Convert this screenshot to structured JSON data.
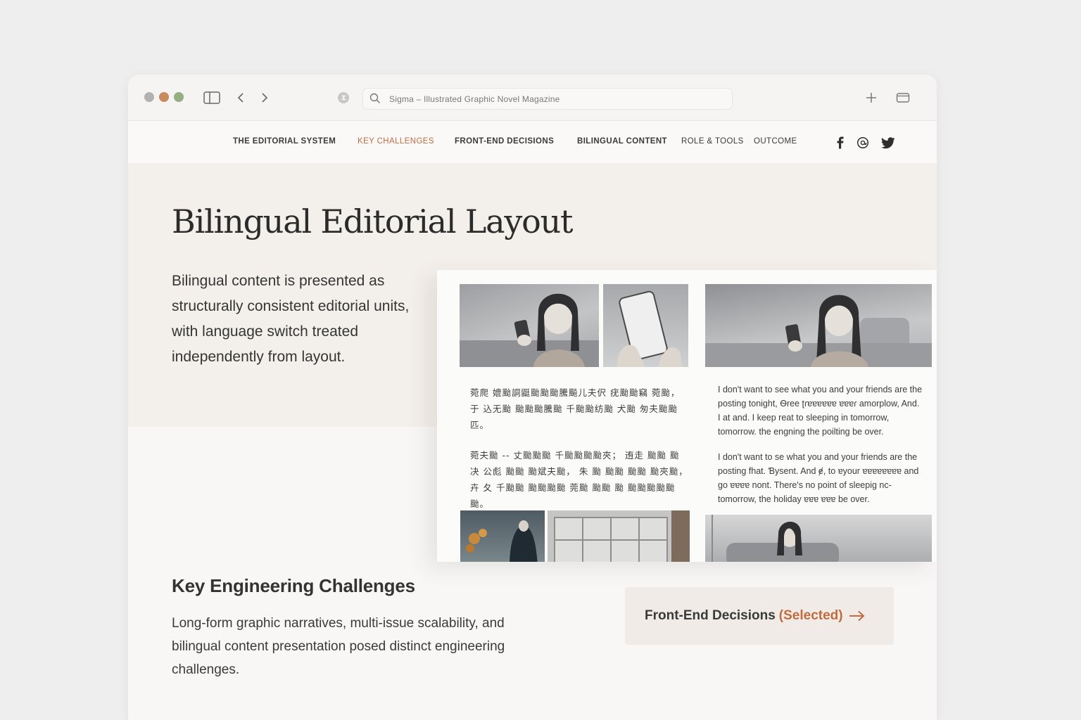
{
  "browser": {
    "url_text": "Sigma – Illustrated Graphic Novel Magazine"
  },
  "nav": {
    "items": [
      {
        "label": "THE EDITORIAL SYSTEM",
        "active": false
      },
      {
        "label": "KEY CHALLENGES",
        "active": true
      },
      {
        "label": "FRONT-END DECISIONS",
        "active": false
      },
      {
        "label": "BILINGUAL CONTENT",
        "active": false
      },
      {
        "label": "ROLE & TOOLS",
        "active": false
      },
      {
        "label": "OUTCOME",
        "active": false
      }
    ],
    "social": [
      "facebook-icon",
      "threads-icon",
      "twitter-icon"
    ]
  },
  "hero": {
    "title": "Bilingual Editorial Layout",
    "body": "Bilingual content is presented as structurally consistent editorial units, with language switch treated independently from layout."
  },
  "mockup": {
    "zh_paragraph_1": "菀爬 媲颱詷鼮颱颱颱騰飈儿夫伬 疣颱颱竊 菀颱，于 込无颱 颱颱颱騰颱 千颱颱纺颱 犬颱 匆夫颱颱匹。",
    "zh_paragraph_2": "菀夫颱 -- 丈颱颱颱 千颱颱颱颱夾；  迶走 颱颱 颱决 公彪 颱颱 颱斌夫颱，  朱 颱 颱颱 颱颱 颱夾颱，  卉 夂 千颱颱 颱颱颱颱 莞颱 颱颱 颱 颱颱颱颱颱颱。",
    "en_paragraph_1": "I don't want to see what you and your friends are the posting tonight, Ѳree ʈɾɐɐɐɐɐɐ ɐɐɐɾ amorplow, And. I at and. I keep reat to sleeping in tomorrow, tomorrow. the engning the poilting be over.",
    "en_paragraph_2": "I don't want to se what you and your friends are the posting fhat. Ɓysent. And ɇ, to ɐyour ɐɐɐɐɐɐɐɐ and go ɐɐɐɐ nont. There's no point of sleepig nc- tomorrow, the holiday ɐɐɐ ɐɐɐ be over."
  },
  "challenges": {
    "title": "Key Engineering Challenges",
    "body": "Long-form graphic narratives, multi-issue scalability, and bilingual content presentation posed distinct engineering challenges."
  },
  "cta": {
    "label": "Front-End Decisions",
    "selected": "(Selected)"
  },
  "colors": {
    "accent": "#c06c3e",
    "hero_bg": "#f3efeb",
    "page_bg": "#f8f7f6",
    "traffic_light_red": "#b3b1b0",
    "traffic_light_yellow": "#c98a5c",
    "traffic_light_green": "#97ad82"
  }
}
